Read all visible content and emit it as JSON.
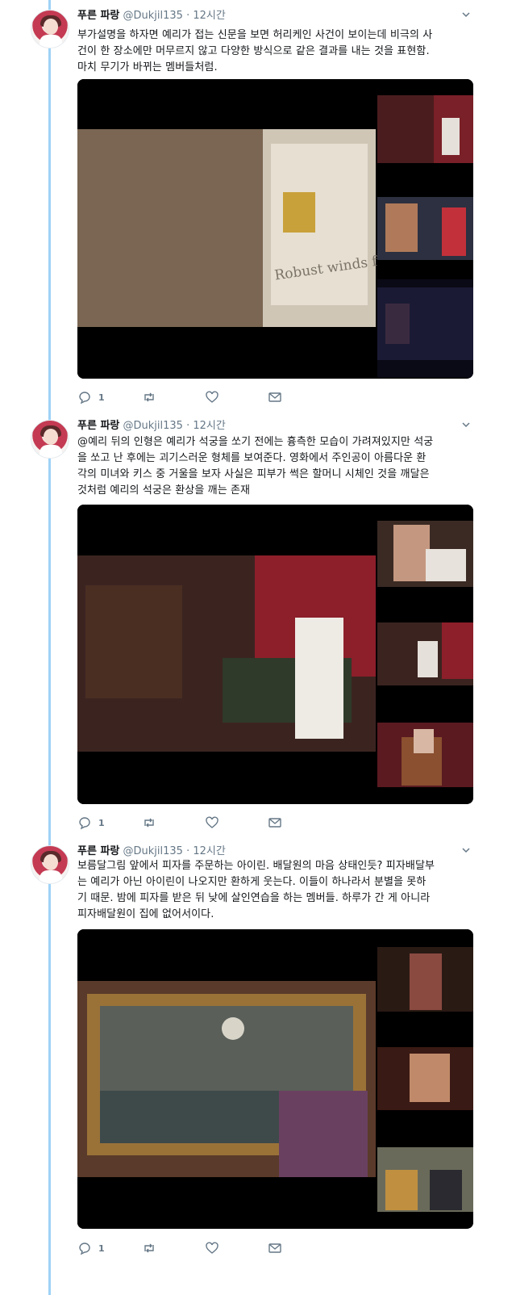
{
  "tweets": [
    {
      "name": "푸른 파랑",
      "handle": "@Dukjil135",
      "separator": "·",
      "time": "12시간",
      "lines": [
        "부가설명을 하자면 예리가 접는 신문을 보면 허리케인 사건이 보이는데 비극의 사",
        "건이 한 장소에만 머무르지 않고 다양한 방식으로 같은 결과를 내는 것을 표현함.",
        "마치 무기가 바뀌는 멤버들처럼."
      ],
      "newspaper_headline": "Robust winds fu",
      "reply_count": "1"
    },
    {
      "name": "푸른 파랑",
      "handle": "@Dukjil135",
      "separator": "·",
      "time": "12시간",
      "lines": [
        "@예리 뒤의 인형은 예리가 석궁을 쏘기 전에는 흉측한 모습이 가려져있지만 석궁",
        "을 쏘고 난 후에는 괴기스러운 형체를 보여준다. 영화에서 주인공이 아름다운 환",
        "각의 미녀와 키스 중 거울을 보자 사실은 피부가 썩은 할머니 시체인 것을 깨달은",
        "것처럼 예리의 석궁은 환상을 깨는 존재"
      ],
      "reply_count": "1"
    },
    {
      "name": "푸른 파랑",
      "handle": "@Dukjil135",
      "separator": "·",
      "time": "12시간",
      "lines": [
        "보름달그림 앞에서 피자를 주문하는 아이린. 배달원의 마음 상태인듯? 피자배달부",
        "는 예리가 아닌 아이린이 나오지만 환하게 웃는다. 이들이 하나라서 분별을 못하",
        "기 때문. 밤에 피자를 받은 뒤 낮에 살인연습을 하는 멤버들. 하루가 간 게 아니라",
        "피자배달원이 집에 없어서이다."
      ],
      "reply_count": "1"
    }
  ],
  "icons": {
    "reply": "reply-icon",
    "retweet": "retweet-icon",
    "like": "heart-icon",
    "dm": "envelope-icon",
    "caret": "chevron-down-icon"
  },
  "colors": {
    "thread_line": "#9fd2f6",
    "secondary_text": "#657786",
    "primary_text": "#14171a"
  }
}
